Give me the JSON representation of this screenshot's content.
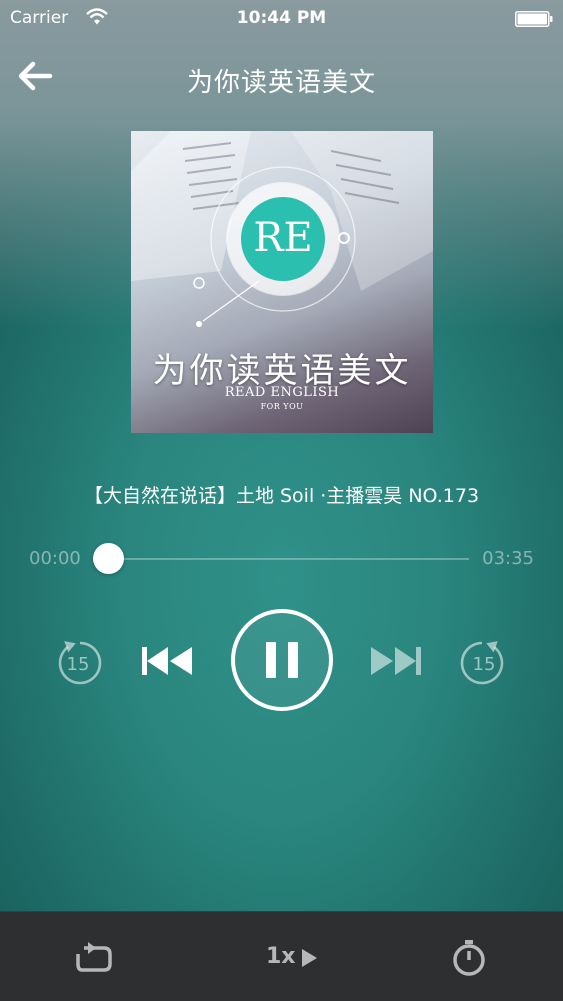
{
  "status_bar": {
    "carrier": "Carrier",
    "time": "10:44 PM",
    "icons": [
      "wifi-icon",
      "battery-icon"
    ]
  },
  "nav": {
    "title": "为你读英语美文",
    "back_icon": "arrow-left-icon"
  },
  "cover": {
    "logo_text": "RE",
    "title": "为你读英语美文",
    "subtitle": "READ ENGLISH",
    "subtitle2": "FOR YOU"
  },
  "track": {
    "title": "【大自然在说话】土地 Soil ·主播雲昊 NO.173"
  },
  "progress": {
    "elapsed": "00:00",
    "duration": "03:35",
    "fraction": 0
  },
  "controls": {
    "rewind_seconds": "15",
    "forward_seconds": "15",
    "state": "playing",
    "icons": [
      "rewind-15-icon",
      "previous-track-icon",
      "pause-icon",
      "next-track-icon",
      "forward-15-icon"
    ]
  },
  "bottom_bar": {
    "speed": "1x",
    "icons": [
      "repeat-icon",
      "play-speed-icon",
      "timer-icon"
    ]
  },
  "colors": {
    "accent": "#2bbfb0",
    "background": "#2a867f",
    "bottom_bar": "#2e2f31"
  }
}
